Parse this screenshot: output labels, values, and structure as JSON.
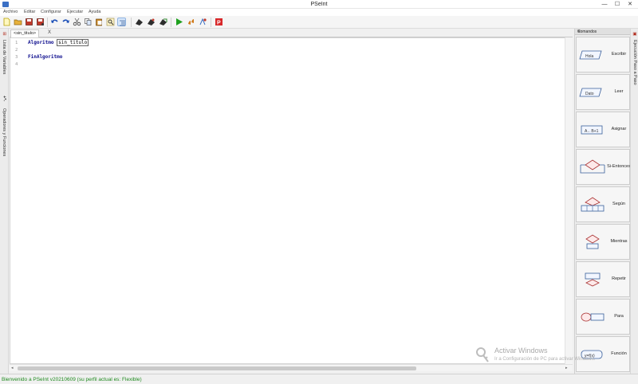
{
  "window": {
    "title": "PSeInt",
    "minimize": "—",
    "maximize": "☐",
    "close": "✕"
  },
  "menu": [
    "Archivo",
    "Editar",
    "Configurar",
    "Ejecutar",
    "Ayuda"
  ],
  "toolbar": {
    "buttons": [
      "new-file",
      "open-file",
      "save",
      "save-as",
      "undo",
      "redo",
      "cut",
      "copy",
      "paste",
      "search",
      "indent",
      "run",
      "step-by-step",
      "debug",
      "flowchart",
      "help"
    ]
  },
  "left_dock": {
    "vars_label": "Lista de Variables",
    "ops_label": "Operadores y Funciones",
    "vars_badge": "⊞",
    "ops_badge": "+*-"
  },
  "editor": {
    "tab_label": "<sin_titulo>",
    "tab_close": "X",
    "lines": [
      {
        "n": "1",
        "kw": "Algoritmo",
        "ident": "sin_titulo"
      },
      {
        "n": "2",
        "kw": "",
        "ident": ""
      },
      {
        "n": "3",
        "kw": "FinAlgoritmo",
        "ident": ""
      },
      {
        "n": "4",
        "kw": "",
        "ident": ""
      }
    ]
  },
  "right_panel": {
    "title": "Comandos",
    "close": "✕",
    "commands": [
      {
        "label": "Escribir",
        "icon": "escribir-icon"
      },
      {
        "label": "Leer",
        "icon": "leer-icon"
      },
      {
        "label": "Asignar",
        "icon": "asignar-icon"
      },
      {
        "label": "Si-Entonces",
        "icon": "si-entonces-icon"
      },
      {
        "label": "Según",
        "icon": "segun-icon"
      },
      {
        "label": "Mientras",
        "icon": "mientras-icon"
      },
      {
        "label": "Repetir",
        "icon": "repetir-icon"
      },
      {
        "label": "Para",
        "icon": "para-icon"
      },
      {
        "label": "Función",
        "icon": "funcion-icon"
      }
    ],
    "icon_texts": {
      "escribir": "Hola",
      "leer": "Dato",
      "asignar": "A←B+1",
      "funcion": "y=f(x)"
    }
  },
  "far_right": {
    "label": "Ejecución Paso a Paso"
  },
  "status": {
    "text": "Bienvenido a PSeInt v20210609 (su perfil actual es: Flexible)"
  },
  "watermark": {
    "line1": "Activar Windows",
    "line2": "Ir a Configuración de PC para activar Windows."
  },
  "colors": {
    "keyword": "#0a0a8c",
    "status_text": "#1f8a1f",
    "panel_bg": "#ededed"
  }
}
